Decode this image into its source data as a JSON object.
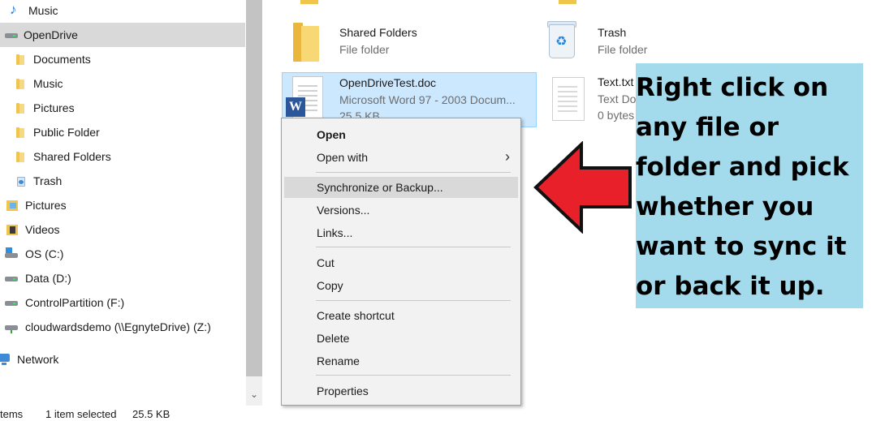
{
  "nav": {
    "items": [
      {
        "label": "Music",
        "icon": "music-icon"
      },
      {
        "label": "OpenDrive",
        "icon": "drive-icon",
        "selected": true
      },
      {
        "label": "Documents",
        "icon": "folder-icon"
      },
      {
        "label": "Music",
        "icon": "folder-icon"
      },
      {
        "label": "Pictures",
        "icon": "folder-icon"
      },
      {
        "label": "Public Folder",
        "icon": "folder-icon"
      },
      {
        "label": "Shared Folders",
        "icon": "folder-icon"
      },
      {
        "label": "Trash",
        "icon": "trash-icon"
      },
      {
        "label": "Pictures",
        "icon": "pictures-icon"
      },
      {
        "label": "Videos",
        "icon": "videos-icon"
      },
      {
        "label": "OS (C:)",
        "icon": "os-drive-icon"
      },
      {
        "label": "Data (D:)",
        "icon": "drive-icon"
      },
      {
        "label": "ControlPartition (F:)",
        "icon": "drive-icon"
      },
      {
        "label": "cloudwardsdemo (\\\\EgnyteDrive) (Z:)",
        "icon": "network-drive-icon"
      },
      {
        "label": "Network",
        "icon": "network-icon"
      }
    ]
  },
  "files": {
    "shared_folders": {
      "name": "Shared Folders",
      "type": "File folder"
    },
    "trash": {
      "name": "Trash",
      "type": "File folder"
    },
    "doc": {
      "name": "OpenDriveTest.doc",
      "type": "Microsoft Word 97 - 2003 Docum...",
      "size": "25.5 KB"
    },
    "text": {
      "name": "Text.txt",
      "type": "Text Do",
      "size": "0 bytes"
    }
  },
  "context_menu": {
    "open": "Open",
    "open_with": "Open with",
    "sync_backup": "Synchronize or Backup...",
    "versions": "Versions...",
    "links": "Links...",
    "cut": "Cut",
    "copy": "Copy",
    "create_shortcut": "Create shortcut",
    "delete": "Delete",
    "rename": "Rename",
    "properties": "Properties"
  },
  "status": {
    "items_fragment": "tems",
    "selected": "1 item selected",
    "size": "25.5 KB"
  },
  "annotation": {
    "text": "Right click on any file or folder and pick whether you want to sync it or back it up."
  },
  "colors": {
    "selection": "#cce8ff",
    "arrow": "#e8202a",
    "annotation_bg": "#a4dbec"
  }
}
